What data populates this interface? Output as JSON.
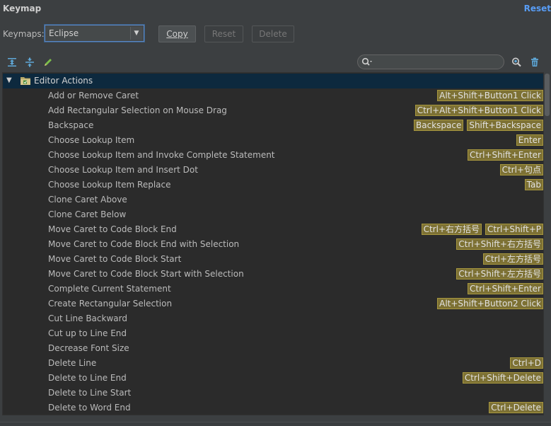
{
  "header": {
    "title": "Keymap",
    "reset_link": "Reset"
  },
  "keymaps": {
    "label": "Keymaps:",
    "selected": "Eclipse",
    "copy_label": "Copy",
    "reset_label": "Reset",
    "delete_label": "Delete"
  },
  "toolbar": {
    "icons": [
      "expand-all-icon",
      "collapse-all-icon",
      "edit-pencil-icon"
    ],
    "search_value": "",
    "right_icons": [
      "find-shortcut-icon",
      "trash-icon"
    ]
  },
  "tree": {
    "group_label": "Editor Actions",
    "rows": [
      {
        "label": "Add or Remove Caret",
        "shortcuts": [
          "Alt+Shift+Button1 Click"
        ]
      },
      {
        "label": "Add Rectangular Selection on Mouse Drag",
        "shortcuts": [
          "Ctrl+Alt+Shift+Button1 Click"
        ]
      },
      {
        "label": "Backspace",
        "shortcuts": [
          "Backspace",
          "Shift+Backspace"
        ]
      },
      {
        "label": "Choose Lookup Item",
        "shortcuts": [
          "Enter"
        ]
      },
      {
        "label": "Choose Lookup Item and Invoke Complete Statement",
        "shortcuts": [
          "Ctrl+Shift+Enter"
        ]
      },
      {
        "label": "Choose Lookup Item and Insert Dot",
        "shortcuts": [
          "Ctrl+句点"
        ]
      },
      {
        "label": "Choose Lookup Item Replace",
        "shortcuts": [
          "Tab"
        ]
      },
      {
        "label": "Clone Caret Above",
        "shortcuts": []
      },
      {
        "label": "Clone Caret Below",
        "shortcuts": []
      },
      {
        "label": "Move Caret to Code Block End",
        "shortcuts": [
          "Ctrl+右方括号",
          "Ctrl+Shift+P"
        ]
      },
      {
        "label": "Move Caret to Code Block End with Selection",
        "shortcuts": [
          "Ctrl+Shift+右方括号"
        ]
      },
      {
        "label": "Move Caret to Code Block Start",
        "shortcuts": [
          "Ctrl+左方括号"
        ]
      },
      {
        "label": "Move Caret to Code Block Start with Selection",
        "shortcuts": [
          "Ctrl+Shift+左方括号"
        ]
      },
      {
        "label": "Complete Current Statement",
        "shortcuts": [
          "Ctrl+Shift+Enter"
        ]
      },
      {
        "label": "Create Rectangular Selection",
        "shortcuts": [
          "Alt+Shift+Button2 Click"
        ]
      },
      {
        "label": "Cut Line Backward",
        "shortcuts": []
      },
      {
        "label": "Cut up to Line End",
        "shortcuts": []
      },
      {
        "label": "Decrease Font Size",
        "shortcuts": []
      },
      {
        "label": "Delete Line",
        "shortcuts": [
          "Ctrl+D"
        ]
      },
      {
        "label": "Delete to Line End",
        "shortcuts": [
          "Ctrl+Shift+Delete"
        ]
      },
      {
        "label": "Delete to Line Start",
        "shortcuts": []
      },
      {
        "label": "Delete to Word End",
        "shortcuts": [
          "Ctrl+Delete"
        ]
      }
    ]
  },
  "colors": {
    "background": "#3c3f41",
    "tree_background": "#2b2b2b",
    "selected_row": "#0d293e",
    "shortcut_badge": "#7d7134",
    "link": "#589df6"
  }
}
